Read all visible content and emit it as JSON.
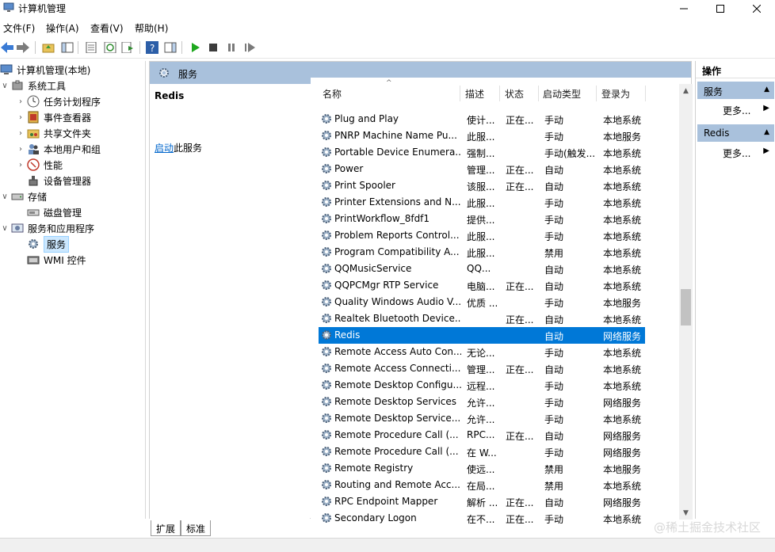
{
  "window": {
    "title": "计算机管理",
    "minimize_icon": "minimize-icon",
    "maximize_icon": "maximize-icon",
    "close_icon": "close-icon"
  },
  "menu": [
    "文件(F)",
    "操作(A)",
    "查看(V)",
    "帮助(H)"
  ],
  "tree": {
    "root": "计算机管理(本地)",
    "system_tools": "系统工具",
    "task_scheduler": "任务计划程序",
    "event_viewer": "事件查看器",
    "shared_folders": "共享文件夹",
    "local_users": "本地用户和组",
    "performance": "性能",
    "device_manager": "设备管理器",
    "storage": "存储",
    "disk_management": "磁盘管理",
    "services_apps": "服务和应用程序",
    "services": "服务",
    "wmi": "WMI 控件"
  },
  "middle": {
    "header_title": "服务",
    "selected_service": "Redis",
    "start_link": "启动",
    "start_suffix": "此服务"
  },
  "columns": {
    "name": "名称",
    "description": "描述",
    "status": "状态",
    "startup": "启动类型",
    "logon": "登录为"
  },
  "services": [
    {
      "name": "Plug and Play",
      "desc": "使计...",
      "status": "正在...",
      "startup": "手动",
      "logon": "本地系统"
    },
    {
      "name": "PNRP Machine Name Pu...",
      "desc": "此服...",
      "status": "",
      "startup": "手动",
      "logon": "本地服务"
    },
    {
      "name": "Portable Device Enumera...",
      "desc": "强制...",
      "status": "",
      "startup": "手动(触发...",
      "logon": "本地系统"
    },
    {
      "name": "Power",
      "desc": "管理...",
      "status": "正在...",
      "startup": "自动",
      "logon": "本地系统"
    },
    {
      "name": "Print Spooler",
      "desc": "该服...",
      "status": "正在...",
      "startup": "自动",
      "logon": "本地系统"
    },
    {
      "name": "Printer Extensions and N...",
      "desc": "此服...",
      "status": "",
      "startup": "手动",
      "logon": "本地系统"
    },
    {
      "name": "PrintWorkflow_8fdf1",
      "desc": "提供...",
      "status": "",
      "startup": "手动",
      "logon": "本地系统"
    },
    {
      "name": "Problem Reports Control...",
      "desc": "此服...",
      "status": "",
      "startup": "手动",
      "logon": "本地系统"
    },
    {
      "name": "Program Compatibility A...",
      "desc": "此服...",
      "status": "",
      "startup": "禁用",
      "logon": "本地系统"
    },
    {
      "name": "QQMusicService",
      "desc": "QQ...",
      "status": "",
      "startup": "自动",
      "logon": "本地系统"
    },
    {
      "name": "QQPCMgr RTP Service",
      "desc": "电脑...",
      "status": "正在...",
      "startup": "自动",
      "logon": "本地系统"
    },
    {
      "name": "Quality Windows Audio V...",
      "desc": "优质 ...",
      "status": "",
      "startup": "手动",
      "logon": "本地服务"
    },
    {
      "name": "Realtek Bluetooth Device...",
      "desc": "",
      "status": "正在...",
      "startup": "自动",
      "logon": "本地系统"
    },
    {
      "name": "Redis",
      "desc": "",
      "status": "",
      "startup": "自动",
      "logon": "网络服务"
    },
    {
      "name": "Remote Access Auto Con...",
      "desc": "无论...",
      "status": "",
      "startup": "手动",
      "logon": "本地系统"
    },
    {
      "name": "Remote Access Connecti...",
      "desc": "管理...",
      "status": "正在...",
      "startup": "自动",
      "logon": "本地系统"
    },
    {
      "name": "Remote Desktop Configu...",
      "desc": "远程...",
      "status": "",
      "startup": "手动",
      "logon": "本地系统"
    },
    {
      "name": "Remote Desktop Services",
      "desc": "允许...",
      "status": "",
      "startup": "手动",
      "logon": "网络服务"
    },
    {
      "name": "Remote Desktop Service...",
      "desc": "允许...",
      "status": "",
      "startup": "手动",
      "logon": "本地系统"
    },
    {
      "name": "Remote Procedure Call (...",
      "desc": "RPC...",
      "status": "正在...",
      "startup": "自动",
      "logon": "网络服务"
    },
    {
      "name": "Remote Procedure Call (...",
      "desc": "在 W...",
      "status": "",
      "startup": "手动",
      "logon": "网络服务"
    },
    {
      "name": "Remote Registry",
      "desc": "使远...",
      "status": "",
      "startup": "禁用",
      "logon": "本地服务"
    },
    {
      "name": "Routing and Remote Acc...",
      "desc": "在局...",
      "status": "",
      "startup": "禁用",
      "logon": "本地系统"
    },
    {
      "name": "RPC Endpoint Mapper",
      "desc": "解析 ...",
      "status": "正在...",
      "startup": "自动",
      "logon": "网络服务"
    },
    {
      "name": "Secondary Logon",
      "desc": "在不...",
      "status": "正在...",
      "startup": "手动",
      "logon": "本地系统"
    }
  ],
  "selected_row_index": 13,
  "scrollbar_position": 0.47,
  "tabs": [
    "扩展",
    "标准"
  ],
  "actions": {
    "title": "操作",
    "section1": "服务",
    "more1": "更多...",
    "section2": "Redis",
    "more2": "更多..."
  },
  "watermark": "@稀土掘金技术社区",
  "colors": {
    "selection": "#0078d7",
    "header_bar": "#a9c1dc"
  }
}
